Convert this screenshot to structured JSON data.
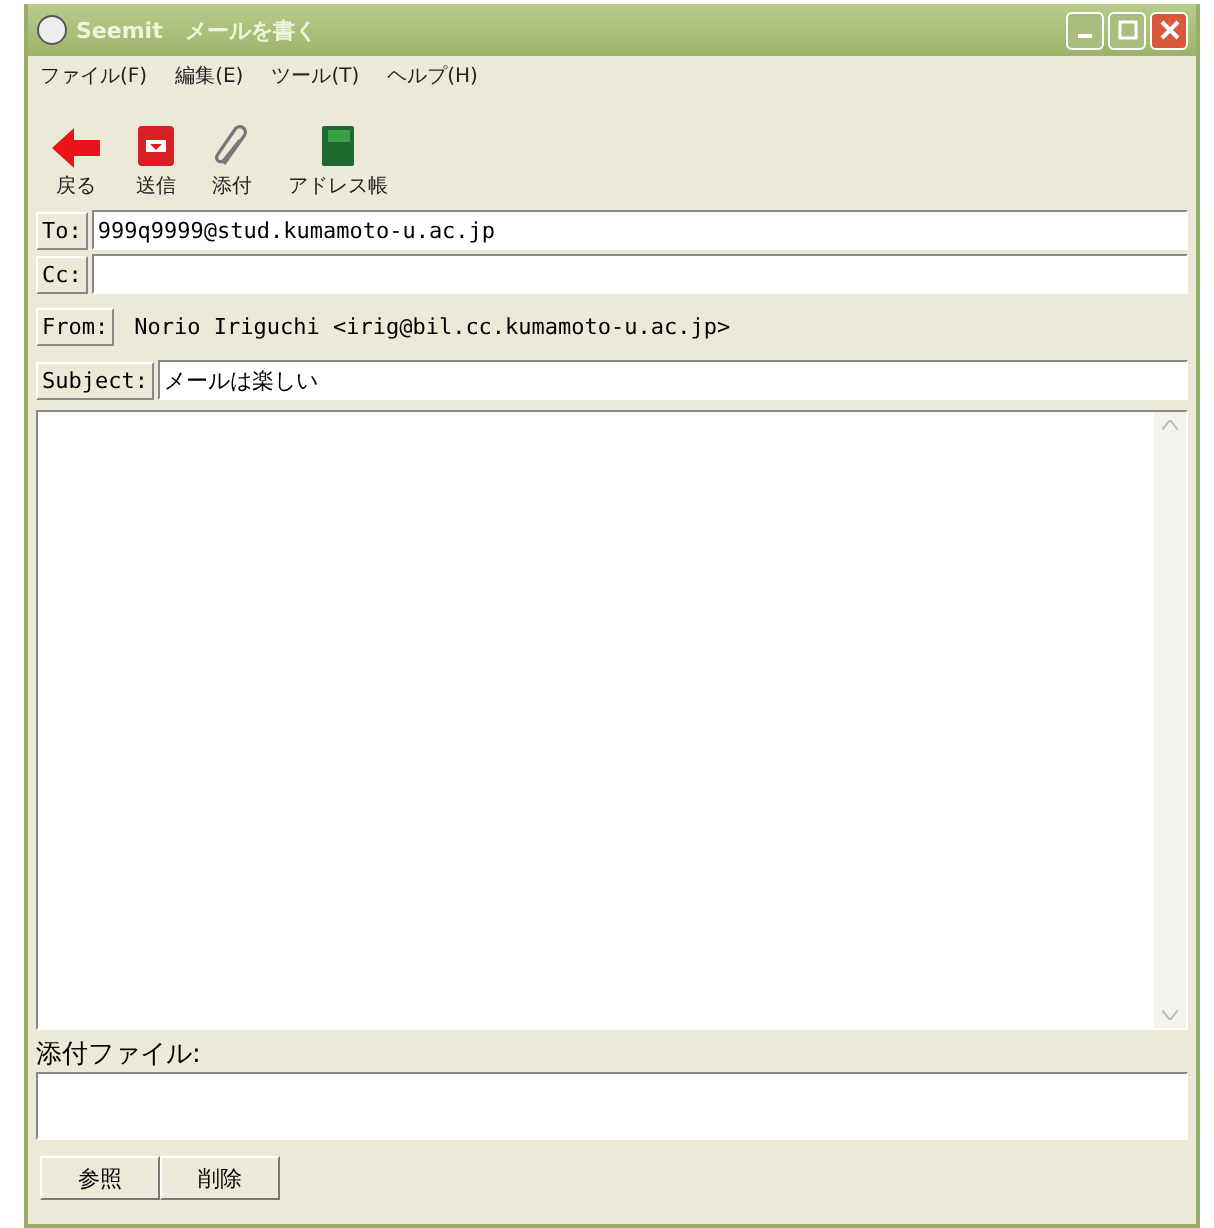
{
  "window": {
    "title": "Seemit　メールを書く"
  },
  "menu": [
    "ファイル(F)",
    "編集(E)",
    "ツール(T)",
    "ヘルプ(H)"
  ],
  "toolbar": [
    {
      "kind": "back",
      "label": "戻る"
    },
    {
      "kind": "send",
      "label": "送信"
    },
    {
      "kind": "attach",
      "label": "添付"
    },
    {
      "kind": "book",
      "label": "アドレス帳"
    }
  ],
  "header_fields": [
    {
      "kind": "field",
      "label": "To:",
      "value": "999q9999@stud.kumamoto-u.ac.jp"
    },
    {
      "kind": "field",
      "label": "Cc:"
    },
    {
      "kind": "text",
      "label": "From:",
      "value": "Norio Iriguchi <irig@bil.cc.kumamoto-u.ac.jp>"
    },
    {
      "kind": "field",
      "label": "Subject:",
      "value": "メールは楽しい"
    }
  ],
  "attachments": {
    "label": "添付ファイル:"
  },
  "buttons": [
    "参照",
    "削除"
  ]
}
